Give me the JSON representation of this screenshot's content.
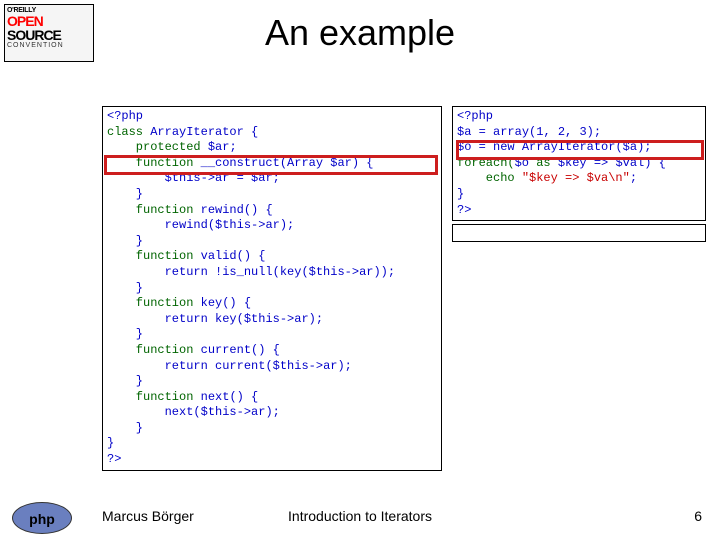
{
  "title": "An example",
  "logo": {
    "line1": "O'REILLY",
    "line2": "OPEN",
    "line3": "SOURCE",
    "line4": "CONVENTION"
  },
  "php_logo_text": "php",
  "code_left": {
    "l1_open": "<?php",
    "l2_kw": "class ",
    "l2_name": "ArrayIterator ",
    "l2_brace": "{",
    "l3_kw": "    protected ",
    "l3_var": "$ar",
    "l3_semi": ";",
    "l4_kw": "    function ",
    "l4_name": "__construct",
    "l4_p1": "(",
    "l4_type": "Array ",
    "l4_var": "$ar",
    "l4_p2": ") {",
    "l5_this": "        $this",
    "l5_arrow": "->",
    "l5_ar": "ar ",
    "l5_eq": "= ",
    "l5_var": "$ar",
    "l5_semi": ";",
    "l6_close": "    }",
    "l7_kw": "    function ",
    "l7_name": "rewind",
    "l7_paren": "() {",
    "l8_fn": "        rewind",
    "l8_p1": "(",
    "l8_this": "$this",
    "l8_arrow": "->",
    "l8_ar": "ar",
    "l8_p2": ");",
    "l9_close": "    }",
    "l10_kw": "    function ",
    "l10_name": "valid",
    "l10_paren": "() {",
    "l11_ret": "        return !",
    "l11_fn": "is_null",
    "l11_p1": "(",
    "l11_fn2": "key",
    "l11_p2": "(",
    "l11_this": "$this",
    "l11_arrow": "->",
    "l11_ar": "ar",
    "l11_p3": "));",
    "l12_close": "    }",
    "l13_kw": "    function ",
    "l13_name": "key",
    "l13_paren": "() {",
    "l14_ret": "        return ",
    "l14_fn": "key",
    "l14_p1": "(",
    "l14_this": "$this",
    "l14_arrow": "->",
    "l14_ar": "ar",
    "l14_p2": ");",
    "l15_close": "    }",
    "l16_kw": "    function ",
    "l16_name": "current",
    "l16_paren": "() {",
    "l17_ret": "        return ",
    "l17_fn": "current",
    "l17_p1": "(",
    "l17_this": "$this",
    "l17_arrow": "->",
    "l17_ar": "ar",
    "l17_p2": ");",
    "l18_close": "    }",
    "l19_kw": "    function ",
    "l19_name": "next",
    "l19_paren": "() {",
    "l20_fn": "        next",
    "l20_p1": "(",
    "l20_this": "$this",
    "l20_arrow": "->",
    "l20_ar": "ar",
    "l20_p2": ");",
    "l21_close": "    }",
    "l22_close": "}",
    "l23_close": "?>"
  },
  "code_right": {
    "r1_open": "<?php",
    "r2_var": "$a ",
    "r2_eq": "= ",
    "r2_fn": "array",
    "r2_p1": "(",
    "r2_n1": "1",
    "r2_c1": ", ",
    "r2_n2": "2",
    "r2_c2": ", ",
    "r2_n3": "3",
    "r2_p2": ");",
    "r3_var": "$o ",
    "r3_eq": "= new ",
    "r3_cls": "ArrayIterator",
    "r3_p1": "(",
    "r3_arg": "$a",
    "r3_p2": ");",
    "r4_kw": "foreach(",
    "r4_o": "$o ",
    "r4_as": "as ",
    "r4_key": "$key ",
    "r4_arrow": "=> ",
    "r4_val": "$val",
    "r4_p2": ") {",
    "r5_echo": "    echo ",
    "r5_s1": "\"$key => $va\\n\"",
    "r5_semi": ";",
    "r6_close": "}",
    "r7_close": "?>"
  },
  "footer": {
    "author": "Marcus Börger",
    "title": "Introduction to Iterators",
    "page": "6"
  }
}
